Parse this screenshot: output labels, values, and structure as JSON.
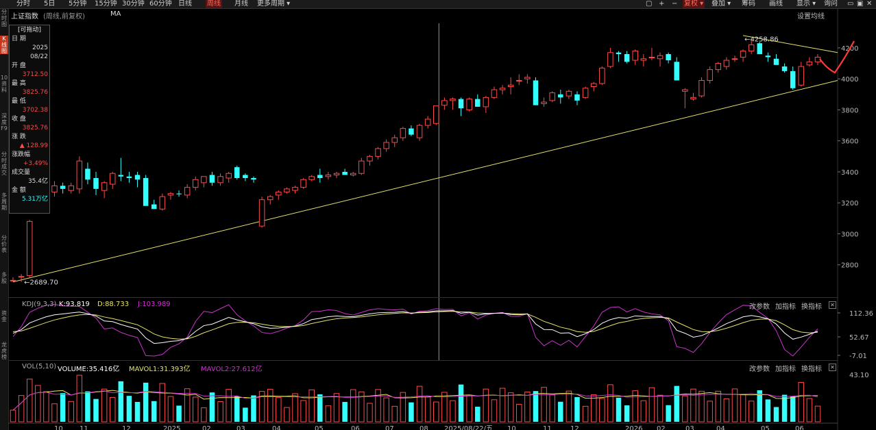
{
  "toolbar": {
    "periods": [
      "分时",
      "5日",
      "5分钟",
      "15分钟",
      "30分钟",
      "60分钟",
      "日线",
      "周线",
      "月线",
      "更多周期"
    ],
    "active_period": "周线",
    "right": [
      "复权",
      "叠加",
      "筹码",
      "画线",
      "显示",
      "询问"
    ],
    "active_right": "复权"
  },
  "sidebar": {
    "items": [
      "分时图",
      "K线图",
      "10资料",
      "深度F9",
      "分时成交",
      "多周期",
      "分价表",
      "多股",
      "资金",
      "龙虎榜"
    ],
    "active": "K线图"
  },
  "header": {
    "title": "上证指数",
    "subtitle": "(周线,前复权)",
    "ma": "MA",
    "ma_setting": "设置均线"
  },
  "infobox": {
    "head": "[可拖动]",
    "rows": [
      {
        "label": "日 期",
        "value": "2025\n08/22",
        "color": "wh"
      },
      {
        "label": "开 盘",
        "value": "3712.50",
        "color": "up"
      },
      {
        "label": "最 高",
        "value": "3825.76",
        "color": "up"
      },
      {
        "label": "最 低",
        "value": "3702.38",
        "color": "up"
      },
      {
        "label": "收 盘",
        "value": "3825.76",
        "color": "up"
      },
      {
        "label": "涨 跌",
        "value": "▲ 128.99",
        "color": "up"
      },
      {
        "label": "涨跌幅",
        "value": "+3.49%",
        "color": "up"
      },
      {
        "label": "成交量",
        "value": "35.4亿",
        "color": "wh"
      },
      {
        "label": "金 额",
        "value": "5.31万亿",
        "color": "cy"
      }
    ]
  },
  "annotations": {
    "high_label": "←4258.86",
    "low_label": "←2689.70",
    "cursor_date": "2025/08/22/五"
  },
  "kdj": {
    "name": "KDJ(9,3,3)",
    "k": "K:93.819",
    "d": "D:88.733",
    "j": "J:103.989",
    "axis": [
      "112.36",
      "52.67",
      "-7.01"
    ],
    "buttons": [
      "改参数",
      "加指标",
      "换指标"
    ]
  },
  "vol": {
    "name": "VOL(5,10)",
    "volume": "VOLUME:35.416亿",
    "mavol1": "MAVOL1:31.393亿",
    "mavol2": "MAVOL2:27.612亿",
    "axis": [
      "43.10"
    ],
    "buttons": [
      "改参数",
      "加指标",
      "换指标"
    ]
  },
  "colors": {
    "up": "#ff4a4a",
    "down": "#33ffff",
    "trend": "#e6e36a",
    "k_line": "#ffffff",
    "d_line": "#e6e36a",
    "j_line": "#cc33cc",
    "background": "#000000"
  },
  "chart_data": {
    "type": "candlestick",
    "title": "上证指数",
    "ylim": [
      2600,
      4350
    ],
    "yticks": [
      2800,
      3000,
      3200,
      3400,
      3600,
      3800,
      4000,
      4200
    ],
    "xticks": [
      "10",
      "11",
      "12",
      "2025",
      "02",
      "03",
      "04",
      "05",
      "06",
      "07",
      "08",
      "2025/08/22/五",
      "10",
      "11",
      "12",
      "2026",
      "02",
      "03",
      "04",
      "05",
      "06"
    ],
    "candles": [
      [
        2700,
        2720,
        2690,
        2700
      ],
      [
        2720,
        2740,
        2689.7,
        2725
      ],
      [
        2730,
        3090,
        2720,
        3080
      ],
      [
        3200,
        3300,
        3180,
        3240
      ],
      [
        3250,
        3310,
        3160,
        3280
      ],
      [
        3270,
        3340,
        3240,
        3310
      ],
      [
        3310,
        3330,
        3260,
        3290
      ],
      [
        3280,
        3330,
        3260,
        3310
      ],
      [
        3290,
        3500,
        3260,
        3470
      ],
      [
        3420,
        3460,
        3320,
        3350
      ],
      [
        3360,
        3400,
        3250,
        3290
      ],
      [
        3280,
        3340,
        3230,
        3330
      ],
      [
        3320,
        3400,
        3290,
        3390
      ],
      [
        3380,
        3490,
        3340,
        3370
      ],
      [
        3370,
        3400,
        3330,
        3360
      ],
      [
        3380,
        3400,
        3300,
        3350
      ],
      [
        3360,
        3380,
        3200,
        3180
      ],
      [
        3190,
        3220,
        3170,
        3160
      ],
      [
        3160,
        3260,
        3150,
        3240
      ],
      [
        3250,
        3270,
        3220,
        3260
      ],
      [
        3260,
        3280,
        3240,
        3255
      ],
      [
        3250,
        3320,
        3230,
        3300
      ],
      [
        3300,
        3370,
        3280,
        3350
      ],
      [
        3330,
        3360,
        3300,
        3370
      ],
      [
        3380,
        3400,
        3310,
        3330
      ],
      [
        3330,
        3390,
        3310,
        3370
      ],
      [
        3360,
        3400,
        3330,
        3390
      ],
      [
        3430,
        3440,
        3350,
        3360
      ],
      [
        3380,
        3390,
        3340,
        3360
      ],
      [
        3360,
        3370,
        3330,
        3350
      ],
      [
        3050,
        3240,
        3040,
        3220
      ],
      [
        3220,
        3250,
        3190,
        3240
      ],
      [
        3250,
        3280,
        3220,
        3270
      ],
      [
        3270,
        3300,
        3260,
        3290
      ],
      [
        3280,
        3310,
        3260,
        3300
      ],
      [
        3300,
        3360,
        3290,
        3350
      ],
      [
        3350,
        3380,
        3340,
        3370
      ],
      [
        3380,
        3420,
        3330,
        3360
      ],
      [
        3370,
        3400,
        3350,
        3380
      ],
      [
        3380,
        3400,
        3360,
        3390
      ],
      [
        3400,
        3420,
        3380,
        3380
      ],
      [
        3380,
        3400,
        3370,
        3390
      ],
      [
        3390,
        3490,
        3380,
        3470
      ],
      [
        3470,
        3510,
        3440,
        3500
      ],
      [
        3500,
        3560,
        3480,
        3550
      ],
      [
        3550,
        3610,
        3530,
        3590
      ],
      [
        3590,
        3640,
        3560,
        3620
      ],
      [
        3620,
        3690,
        3600,
        3680
      ],
      [
        3680,
        3700,
        3630,
        3640
      ],
      [
        3620,
        3710,
        3600,
        3700
      ],
      [
        3700,
        3760,
        3680,
        3740
      ],
      [
        3712.5,
        3825.76,
        3702.38,
        3825.76
      ],
      [
        3830,
        3880,
        3800,
        3860
      ],
      [
        3860,
        3880,
        3800,
        3870
      ],
      [
        3870,
        3880,
        3760,
        3810
      ],
      [
        3800,
        3880,
        3790,
        3870
      ],
      [
        3870,
        3900,
        3850,
        3820
      ],
      [
        3820,
        3890,
        3780,
        3880
      ],
      [
        3880,
        3950,
        3870,
        3930
      ],
      [
        3930,
        3960,
        3900,
        3940
      ],
      [
        3950,
        4010,
        3900,
        3960
      ],
      [
        3990,
        4030,
        3960,
        3990
      ],
      [
        4000,
        4030,
        3970,
        4010
      ],
      [
        3990,
        4010,
        3830,
        3830
      ],
      [
        3840,
        3880,
        3820,
        3850
      ],
      [
        3860,
        3920,
        3850,
        3910
      ],
      [
        3900,
        3930,
        3840,
        3880
      ],
      [
        3890,
        3930,
        3870,
        3920
      ],
      [
        3900,
        3920,
        3830,
        3860
      ],
      [
        3880,
        3950,
        3870,
        3940
      ],
      [
        3950,
        3980,
        3920,
        3970
      ],
      [
        3970,
        4080,
        3960,
        4070
      ],
      [
        4080,
        4200,
        4070,
        4170
      ],
      [
        4170,
        4180,
        4110,
        4160
      ],
      [
        4160,
        4180,
        4100,
        4110
      ],
      [
        4120,
        4190,
        4090,
        4180
      ],
      [
        4120,
        4160,
        4080,
        4130
      ],
      [
        4140,
        4200,
        4120,
        4140
      ],
      [
        4130,
        4170,
        4080,
        4150
      ],
      [
        4160,
        4170,
        4100,
        4120
      ],
      [
        4110,
        4140,
        3990,
        3990
      ],
      [
        3920,
        3940,
        3810,
        3930
      ],
      [
        3870,
        3910,
        3860,
        3880
      ],
      [
        3890,
        4010,
        3880,
        3990
      ],
      [
        3990,
        4080,
        3970,
        4060
      ],
      [
        4060,
        4110,
        4040,
        4100
      ],
      [
        4080,
        4140,
        4060,
        4120
      ],
      [
        4130,
        4150,
        4110,
        4130
      ],
      [
        4140,
        4190,
        4110,
        4180
      ],
      [
        4180,
        4258.86,
        4160,
        4220
      ],
      [
        4230,
        4240,
        4170,
        4160
      ],
      [
        4150,
        4170,
        4110,
        4140
      ],
      [
        4130,
        4160,
        4090,
        4090
      ],
      [
        4080,
        4100,
        4040,
        4050
      ],
      [
        4050,
        4080,
        3930,
        3940
      ],
      [
        3960,
        4110,
        3950,
        4080
      ],
      [
        4090,
        4140,
        4080,
        4110
      ],
      [
        4110,
        4160,
        4090,
        4140
      ]
    ],
    "trendlines": [
      {
        "name": "support",
        "from": [
          0,
          2689.7
        ],
        "to": [
          101,
          3990
        ]
      },
      {
        "name": "resistance",
        "from": [
          88,
          4280
        ],
        "to": [
          101,
          4170
        ]
      }
    ]
  }
}
